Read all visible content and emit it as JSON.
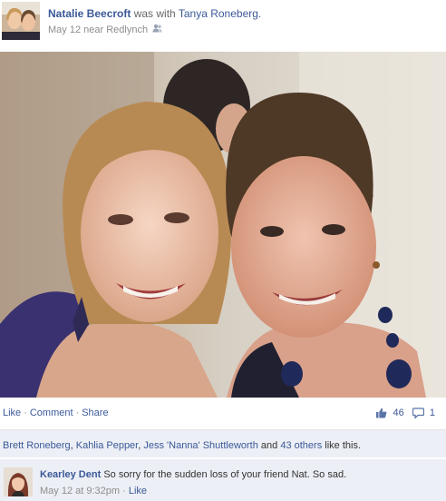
{
  "post": {
    "author": "Natalie Beecroft",
    "with_text": "was with",
    "tagged": "Tanya Roneberg.",
    "date": "May 12 near Redlynch",
    "audience_icon": "friends-icon",
    "avatar_icon": "profile-photo"
  },
  "photo": {
    "description_icon": "photo"
  },
  "actions": {
    "like": "Like",
    "comment": "Comment",
    "share": "Share",
    "separator": "·",
    "like_count": "46",
    "comment_count": "1",
    "like_icon": "thumbs-up-icon",
    "comment_icon": "comment-bubble-icon"
  },
  "likes": {
    "names": [
      "Brett Roneberg",
      "Kahlia Pepper",
      "Jess 'Nanna' Shuttleworth"
    ],
    "comma": ", ",
    "and_text": " and ",
    "others": "43 others",
    "suffix": " like this."
  },
  "comment": {
    "author": "Kearley Dent",
    "text": " So sorry for the sudden loss of your friend Nat. So sad.",
    "time": "May 12 at 9:32pm",
    "separator": " · ",
    "like": "Like"
  },
  "colors": {
    "link": "#3b5998",
    "muted": "#8d8d8d",
    "panel": "#eceff5"
  }
}
